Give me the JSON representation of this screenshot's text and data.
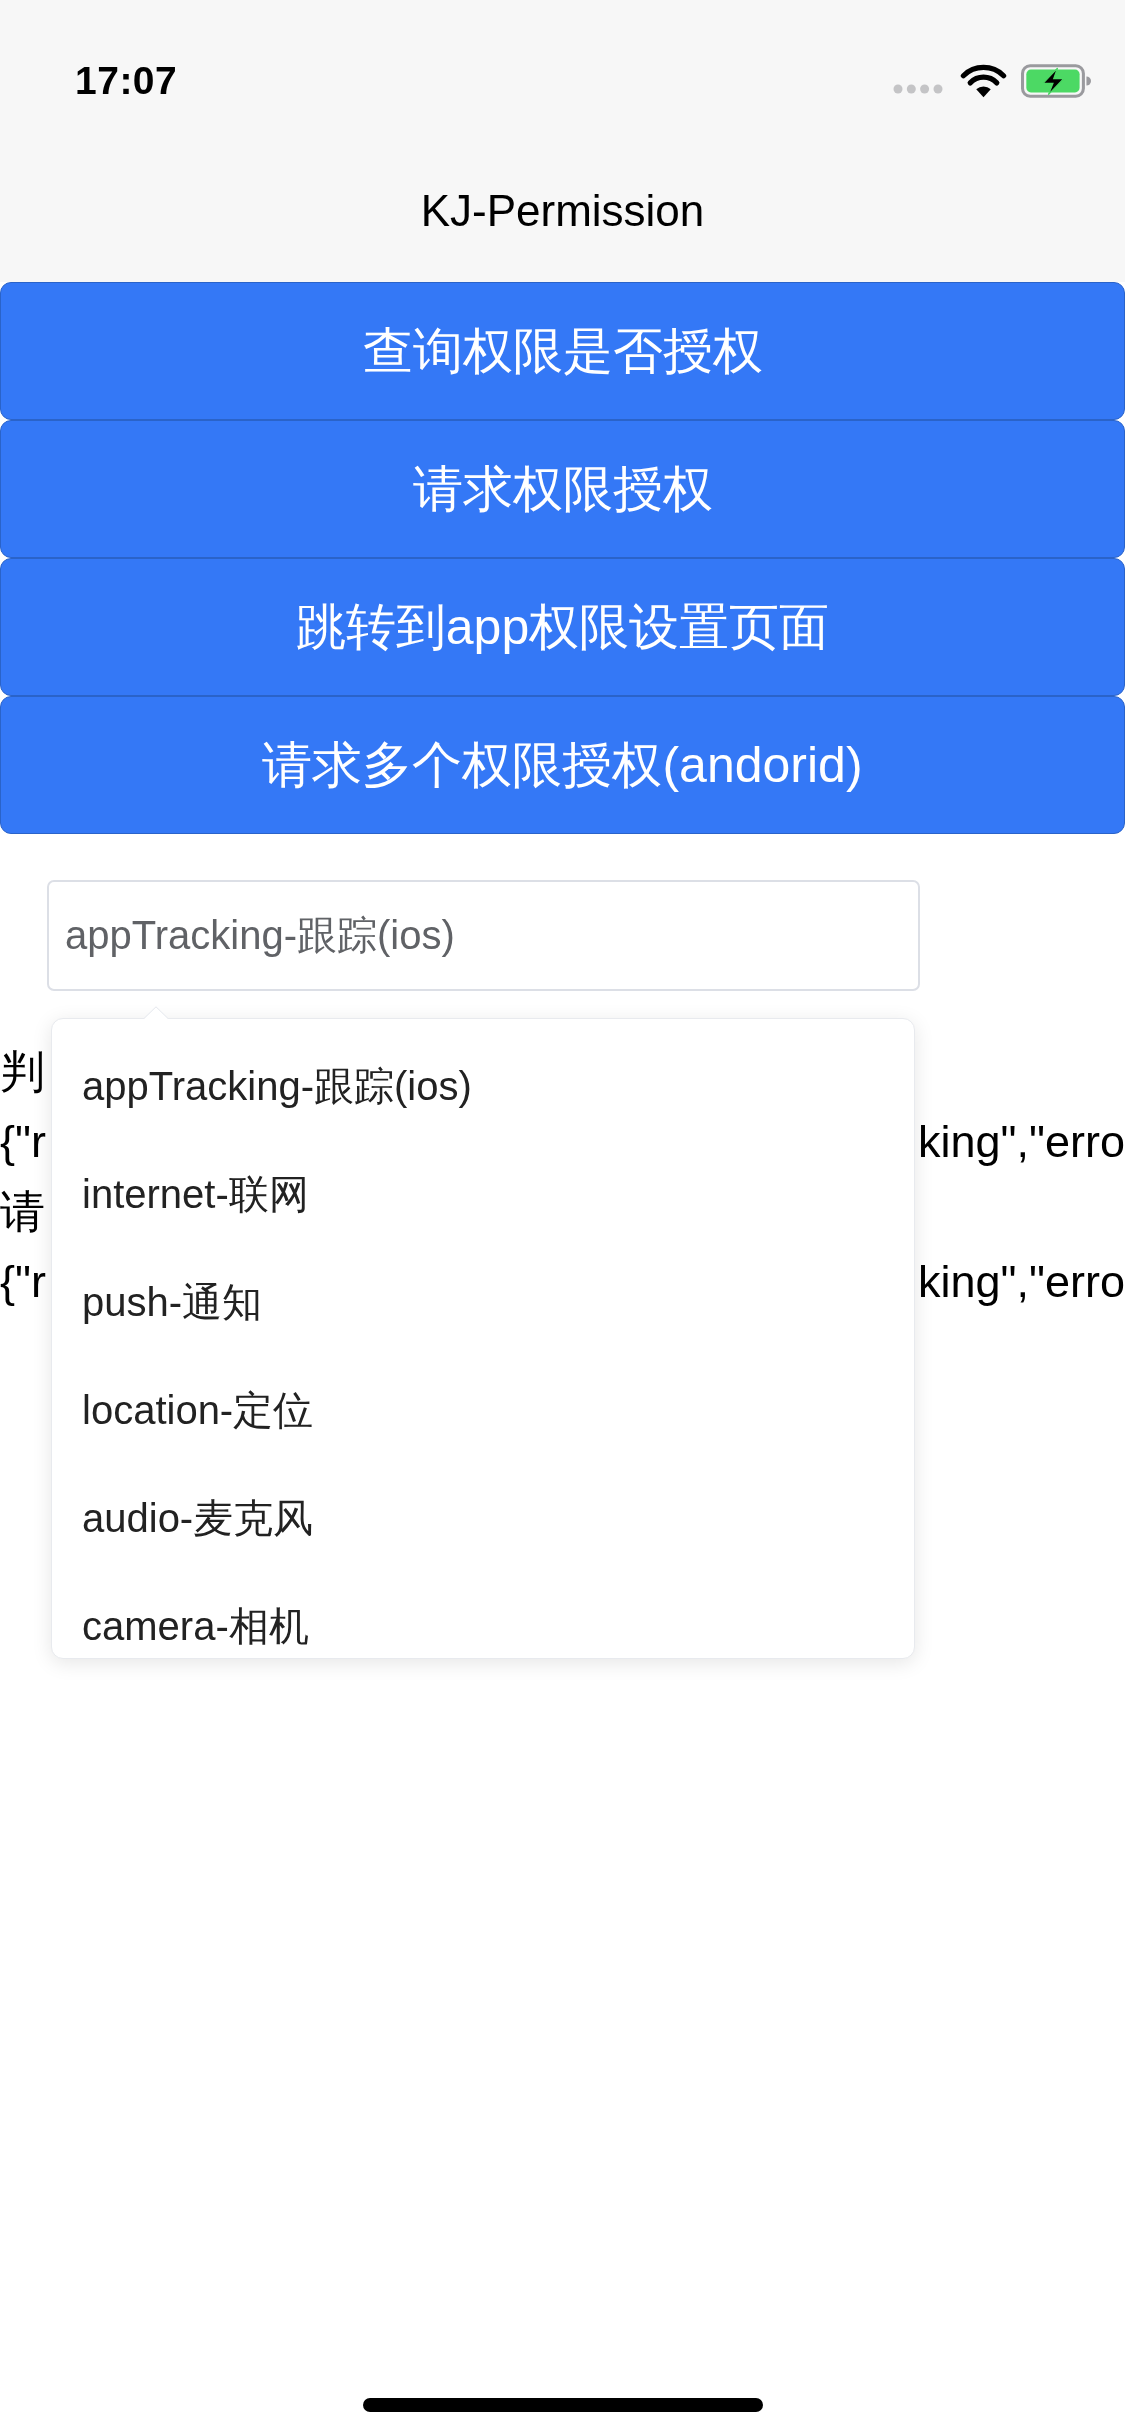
{
  "status_bar": {
    "time": "17:07"
  },
  "nav_bar": {
    "title": "KJ-Permission"
  },
  "buttons": [
    {
      "label": "查询权限是否授权"
    },
    {
      "label": "请求权限授权"
    },
    {
      "label": "跳转到app权限设置页面"
    },
    {
      "label": "请求多个权限授权(andorid)"
    }
  ],
  "select": {
    "value": "appTracking-跟踪(ios)",
    "open": true,
    "options": [
      {
        "label": "appTracking-跟踪(ios)"
      },
      {
        "label": "internet-联网"
      },
      {
        "label": "push-通知"
      },
      {
        "label": "location-定位"
      },
      {
        "label": "audio-麦克风"
      },
      {
        "label": "camera-相机"
      }
    ]
  },
  "results": [
    {
      "start": "判"
    },
    {
      "start": "{\"r",
      "end": "king\",\"erro"
    },
    {
      "start": "请"
    },
    {
      "start": "{\"r",
      "end": "king\",\"erro"
    }
  ]
}
